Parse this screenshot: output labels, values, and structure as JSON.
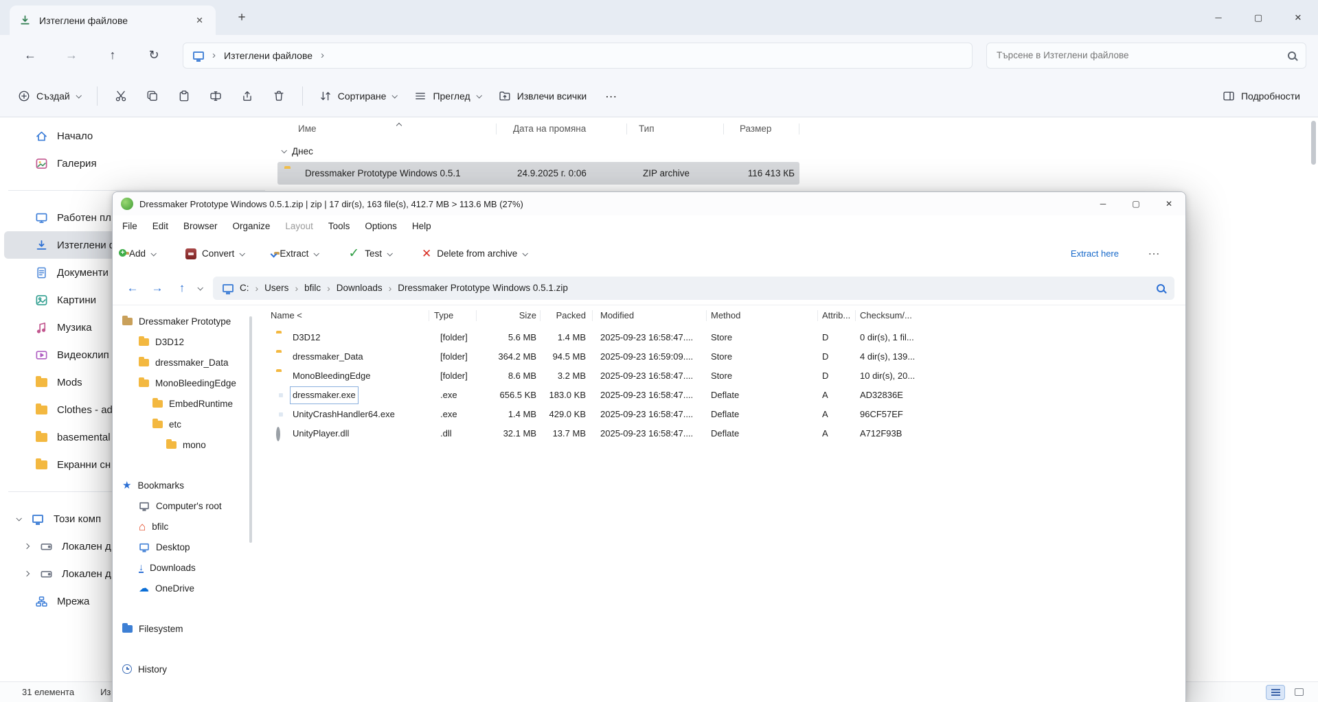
{
  "explorer": {
    "tab_title": "Изтеглени файлове",
    "new_tab_label": "+",
    "breadcrumb_location": "Изтеглени файлове",
    "search_placeholder": "Търсене в Изтеглени файлове",
    "toolbar": {
      "new_label": "Създай",
      "sort_label": "Сортиране",
      "view_label": "Преглед",
      "extract_all_label": "Извлечи всички",
      "more_label": "…",
      "details_label": "Подробности"
    },
    "columns": {
      "name": "Име",
      "date": "Дата на промяна",
      "type": "Тип",
      "size": "Размер"
    },
    "group_label": "Днес",
    "file": {
      "name": "Dressmaker Prototype Windows 0.5.1",
      "date": "24.9.2025 г. 0:06",
      "type": "ZIP archive",
      "size": "116 413 КБ"
    },
    "sidebar": {
      "items": [
        "Начало",
        "Галерия",
        "Работен пл",
        "Изтеглени ф",
        "Документи",
        "Картини",
        "Музика",
        "Видеоклип",
        "Mods",
        "Clothes - ad",
        "basemental",
        "Екранни сн",
        "Този комп",
        "Локален д",
        "Локален д",
        "Мрежа"
      ]
    },
    "status": {
      "count": "31 елемента",
      "selection": "Из"
    }
  },
  "peazip": {
    "title": "Dressmaker Prototype Windows 0.5.1.zip | zip | 17 dir(s), 163 file(s), 412.7 MB > 113.6 MB (27%)",
    "menu": [
      "File",
      "Edit",
      "Browser",
      "Organize",
      "Layout",
      "Tools",
      "Options",
      "Help"
    ],
    "toolbar": {
      "add_label": "Add",
      "convert_label": "Convert",
      "extract_label": "Extract",
      "test_label": "Test",
      "delete_label": "Delete from archive",
      "extract_here_label": "Extract here",
      "more_label": "…"
    },
    "crumbs": [
      "C:",
      "Users",
      "bfilc",
      "Downloads",
      "Dressmaker Prototype Windows 0.5.1.zip"
    ],
    "tree": {
      "items": [
        "Dressmaker Prototype",
        "D3D12",
        "dressmaker_Data",
        "MonoBleedingEdge",
        "EmbedRuntime",
        "etc",
        "mono",
        "Bookmarks",
        "Computer's root",
        "bfilc",
        "Desktop",
        "Downloads",
        "OneDrive",
        "Filesystem",
        "History"
      ]
    },
    "columns": [
      "Name <",
      "Type",
      "Size",
      "Packed",
      "Modified",
      "Method",
      "Attrib...",
      "Checksum/..."
    ],
    "rows": [
      {
        "name": "D3D12",
        "type": "[folder]",
        "size": "5.6 MB",
        "packed": "1.4 MB",
        "modified": "2025-09-23 16:58:47....",
        "method": "Store",
        "attrib": "D",
        "checksum": "0 dir(s), 1 fil..."
      },
      {
        "name": "dressmaker_Data",
        "type": "[folder]",
        "size": "364.2 MB",
        "packed": "94.5 MB",
        "modified": "2025-09-23 16:59:09....",
        "method": "Store",
        "attrib": "D",
        "checksum": "4 dir(s), 139..."
      },
      {
        "name": "MonoBleedingEdge",
        "type": "[folder]",
        "size": "8.6 MB",
        "packed": "3.2 MB",
        "modified": "2025-09-23 16:58:47....",
        "method": "Store",
        "attrib": "D",
        "checksum": "10 dir(s), 20..."
      },
      {
        "name": "dressmaker.exe",
        "type": ".exe",
        "size": "656.5 KB",
        "packed": "183.0 KB",
        "modified": "2025-09-23 16:58:47....",
        "method": "Deflate",
        "attrib": "A",
        "checksum": "AD32836E"
      },
      {
        "name": "UnityCrashHandler64.exe",
        "type": ".exe",
        "size": "1.4 MB",
        "packed": "429.0 KB",
        "modified": "2025-09-23 16:58:47....",
        "method": "Deflate",
        "attrib": "A",
        "checksum": "96CF57EF"
      },
      {
        "name": "UnityPlayer.dll",
        "type": ".dll",
        "size": "32.1 MB",
        "packed": "13.7 MB",
        "modified": "2025-09-23 16:58:47....",
        "method": "Deflate",
        "attrib": "A",
        "checksum": "A712F93B"
      }
    ]
  },
  "colors": {
    "accent_blue": "#2b6fd4",
    "link_blue": "#1668c9",
    "selection_gray": "#d6d8db",
    "folder_yellow": "#f3b840",
    "test_green": "#2f9e44",
    "delete_red": "#d93025"
  }
}
